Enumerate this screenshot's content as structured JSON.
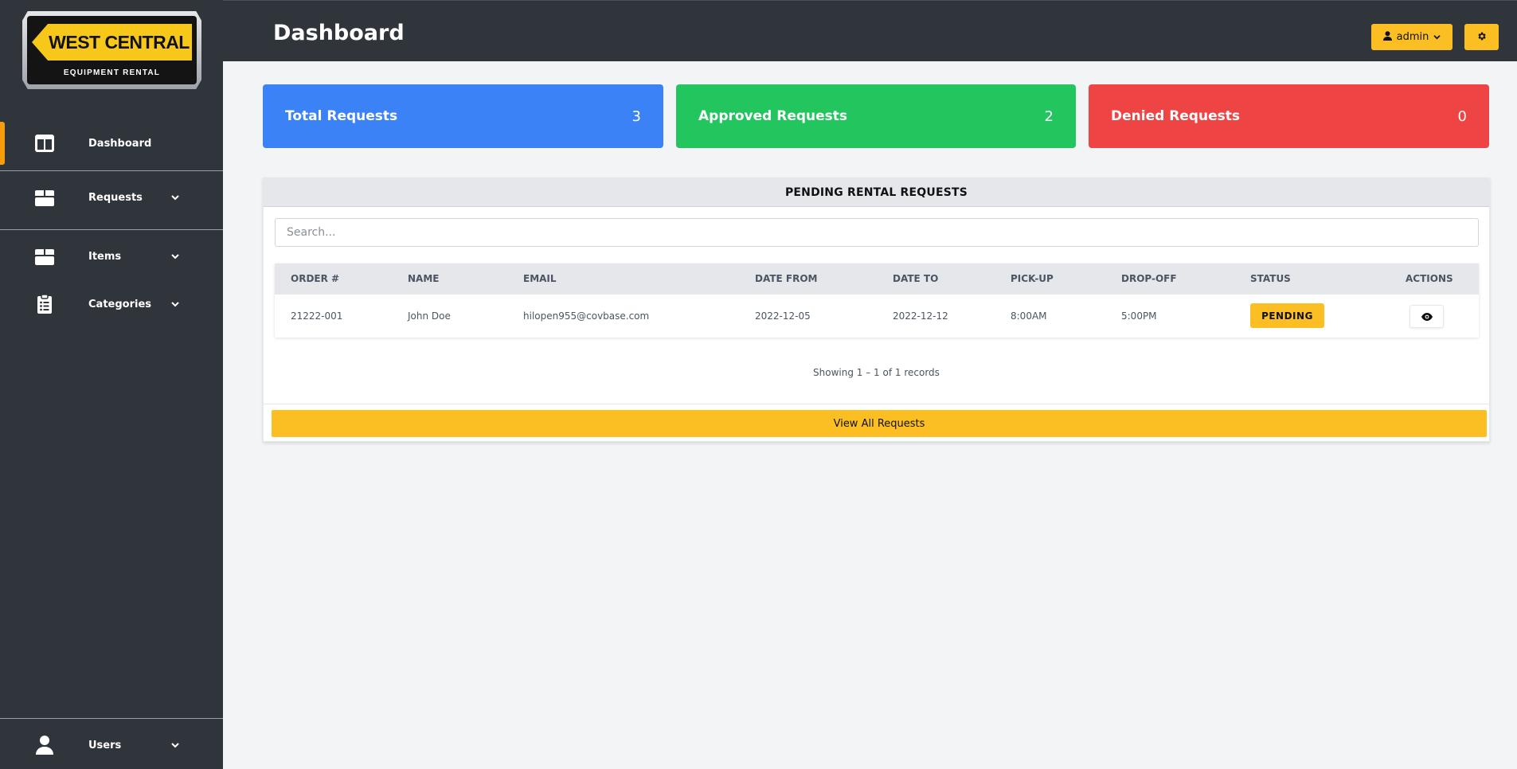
{
  "brand": {
    "title": "WEST CENTRAL",
    "subtitle": "EQUIPMENT RENTAL"
  },
  "sidebar": {
    "items": [
      {
        "label": "Dashboard",
        "icon": "layout-columns-icon",
        "active": true
      },
      {
        "label": "Requests",
        "icon": "box-icon"
      },
      {
        "label": "Items",
        "icon": "box-icon"
      },
      {
        "label": "Categories",
        "icon": "clipboard-list-icon"
      },
      {
        "label": "Users",
        "icon": "user-icon"
      }
    ]
  },
  "header": {
    "title": "Dashboard",
    "user_label": "admin"
  },
  "stats": [
    {
      "label": "Total Requests",
      "value": "3",
      "color": "#3b82f6"
    },
    {
      "label": "Approved Requests",
      "value": "2",
      "color": "#22c55e"
    },
    {
      "label": "Denied Requests",
      "value": "0",
      "color": "#ef4444"
    }
  ],
  "pending": {
    "title": "PENDING RENTAL REQUESTS",
    "search_placeholder": "Search...",
    "columns": [
      "ORDER #",
      "NAME",
      "EMAIL",
      "DATE FROM",
      "DATE TO",
      "PICK-UP",
      "DROP-OFF",
      "STATUS",
      "ACTIONS"
    ],
    "rows": [
      {
        "order": "21222-001",
        "name": "John Doe",
        "email": "hilopen955@covbase.com",
        "date_from": "2022-12-05",
        "date_to": "2022-12-12",
        "pickup": "8:00AM",
        "dropoff": "5:00PM",
        "status": "PENDING"
      }
    ],
    "showing": "Showing 1 – 1 of 1 records",
    "view_all": "View All Requests"
  },
  "colors": {
    "sidebar": "#30343b",
    "accent": "#fbbf24",
    "active_bar": "#f59e0b"
  }
}
